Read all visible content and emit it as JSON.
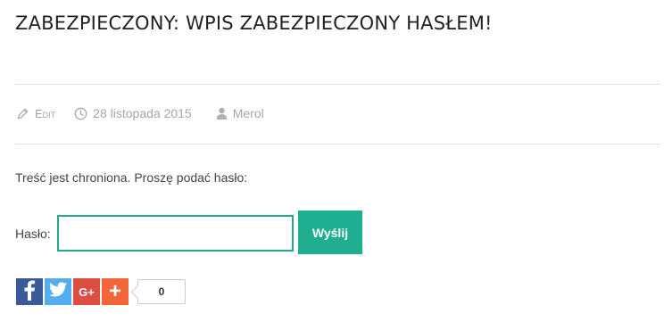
{
  "post": {
    "title": "ZABEZPIECZONY: WPIS ZABEZPIECZONY HASŁEM!",
    "meta": {
      "edit_label": "Edit",
      "date": "28 listopada 2015",
      "author": "Merol"
    },
    "protected_notice": "Treść jest chroniona. Proszę podać hasło:",
    "password_form": {
      "label": "Hasło:",
      "value": "",
      "placeholder": "",
      "submit_label": "Wyślij"
    }
  },
  "share": {
    "buttons": [
      {
        "name": "facebook",
        "glyph": "f",
        "color": "#3b5998"
      },
      {
        "name": "twitter",
        "glyph": "bird",
        "color": "#55acee"
      },
      {
        "name": "google-plus",
        "glyph": "G+",
        "color": "#dc4e41"
      },
      {
        "name": "more",
        "glyph": "+",
        "color": "#f2663a"
      }
    ],
    "count": "0"
  },
  "colors": {
    "accent": "#1fae8f",
    "meta_text": "#a6a6a6"
  }
}
